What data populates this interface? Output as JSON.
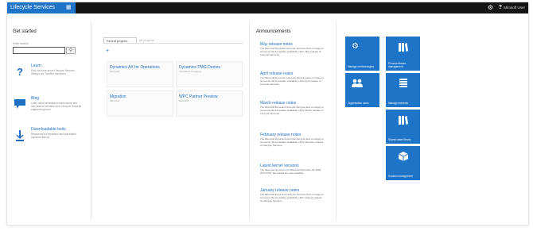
{
  "header": {
    "app_title": "Lifecycle Services",
    "user_name": "Mirosoft User"
  },
  "get_started": {
    "title": "Get started",
    "search_label": "Enter search",
    "search_value": "",
    "items": [
      {
        "title": "Learn",
        "desc": "Find out more about Lifecycle Services through our TechNet resources",
        "icon": "question-icon"
      },
      {
        "title": "Blog",
        "desc": "Learn about scheduled maintenance and new feature releases from Lifecycle Services engineering team",
        "icon": "chat-icon"
      },
      {
        "title": "Downloadable tools",
        "desc": "Resources for expanded and automated implementations",
        "icon": "download-icon"
      }
    ]
  },
  "projects": {
    "tabs": [
      "Recent projects",
      "All projects"
    ],
    "cards": [
      {
        "title": "Dynamics AX for Operations",
        "sub": "Microsoft"
      },
      {
        "title": "Dynamics PMG Demos",
        "sub": "Test Demo Company"
      },
      {
        "title": "Migration",
        "sub": "Microsoft"
      },
      {
        "title": "WPC Partner Preview",
        "sub": "Microsoft"
      }
    ]
  },
  "announcements": {
    "title": "Announcements",
    "items": [
      {
        "title": "May release notes",
        "text": "The Microsoft Dynamics Lifecycle Services team is happy to announce the immediate availability of the May release of Lifecycle Services."
      },
      {
        "title": "April release notes",
        "text": "The Microsoft Dynamics Lifecycle Services team is happy to announce the immediate availability of the April release of Lifecycle Services."
      },
      {
        "title": "March release notes",
        "text": "The Microsoft Dynamics Lifecycle Services team is happy to announce the immediate availability of the March release of Lifecycle Services."
      },
      {
        "title": "February release notes",
        "text": "The Microsoft Dynamics Lifecycle Services team is happy to announce the immediate availability of the February release of Lifecycle Services."
      },
      {
        "title": "Latest kernel versions",
        "text": "The latest kernel version for Microsoft Dynamics AX 2009, 2012 RTM, R2 and R3 are now available."
      },
      {
        "title": "January release notes",
        "text": "The Microsoft Dynamics Lifecycle Services team is happy to announce the immediate availability of the January release of Lifecycle Services."
      }
    ]
  },
  "tiles": [
    {
      "label": "Manage methodologies",
      "icon": "gear-icon"
    },
    {
      "label": "Process feature management",
      "icon": "books-icon"
    },
    {
      "label": "Organization users",
      "icon": "users-icon"
    },
    {
      "label": "Manage incidents",
      "icon": "list-icon"
    },
    {
      "label": "Shared asset library",
      "icon": "books-icon"
    },
    {
      "label": "Solution management",
      "icon": "package-icon"
    }
  ],
  "colors": {
    "accent": "#1e74c8",
    "topbar": "#151515"
  }
}
